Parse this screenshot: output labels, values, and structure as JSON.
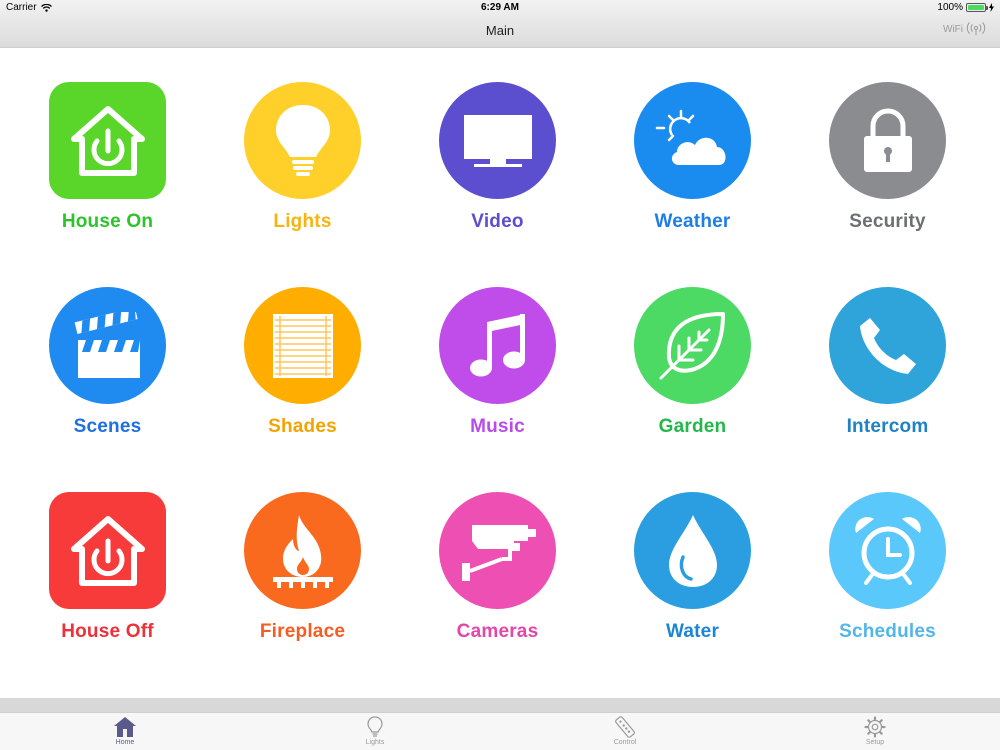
{
  "status_bar": {
    "carrier": "Carrier",
    "time": "6:29 AM",
    "battery": "100%"
  },
  "nav": {
    "title": "Main",
    "wifi_label": "WiFi"
  },
  "tiles": [
    {
      "label": "House On",
      "icon": "house-power-icon",
      "color": "#2bc42b",
      "bg": "#5ad62a"
    },
    {
      "label": "Lights",
      "icon": "lightbulb-icon",
      "color": "#f6b411",
      "bg": "#ffcf2a"
    },
    {
      "label": "Video",
      "icon": "tv-icon",
      "color": "#5b4fcf",
      "bg": "#5b4fcf"
    },
    {
      "label": "Weather",
      "icon": "weather-icon",
      "color": "#1e7ee8",
      "bg": "#1a8cf0"
    },
    {
      "label": "Security",
      "icon": "lock-icon",
      "color": "#6d6f73",
      "bg": "#8a8c90"
    },
    {
      "label": "Scenes",
      "icon": "clapperboard-icon",
      "color": "#1f6fe0",
      "bg": "#1f8af0"
    },
    {
      "label": "Shades",
      "icon": "shades-icon",
      "color": "#f5a300",
      "bg": "#ffae00"
    },
    {
      "label": "Music",
      "icon": "music-note-icon",
      "color": "#b94be8",
      "bg": "#c04dea"
    },
    {
      "label": "Garden",
      "icon": "leaf-icon",
      "color": "#23b84c",
      "bg": "#4cd964"
    },
    {
      "label": "Intercom",
      "icon": "phone-icon",
      "color": "#1f82c4",
      "bg": "#2fa4db"
    },
    {
      "label": "House Off",
      "icon": "house-power-icon",
      "color": "#ee3038",
      "bg": "#f73b3b"
    },
    {
      "label": "Fireplace",
      "icon": "flame-icon",
      "color": "#f55d22",
      "bg": "#fa6a1e"
    },
    {
      "label": "Cameras",
      "icon": "camera-icon",
      "color": "#e447a8",
      "bg": "#ee4fb2"
    },
    {
      "label": "Water",
      "icon": "water-drop-icon",
      "color": "#1c85d6",
      "bg": "#2a9ee0"
    },
    {
      "label": "Schedules",
      "icon": "alarm-clock-icon",
      "color": "#52b6e8",
      "bg": "#5ac8fa"
    }
  ],
  "tabs": [
    {
      "label": "Home",
      "icon": "home-icon",
      "active": true
    },
    {
      "label": "Lights",
      "icon": "lightbulb-icon",
      "active": false
    },
    {
      "label": "Control",
      "icon": "remote-icon",
      "active": false
    },
    {
      "label": "Setup",
      "icon": "gear-icon",
      "active": false
    }
  ]
}
